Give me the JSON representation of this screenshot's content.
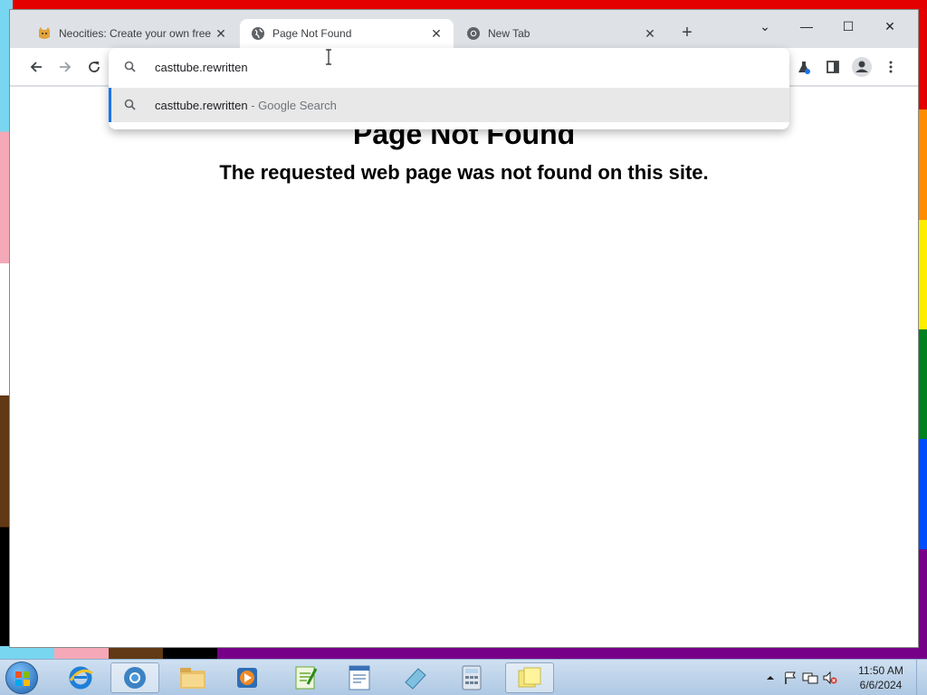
{
  "colors": {
    "wallpaper_stripes": [
      "#e50000",
      "#ff8d00",
      "#ffee00",
      "#028121",
      "#004cff",
      "#770088"
    ],
    "wallpaper_left": [
      "#78d6f0",
      "#f5a9b8",
      "#ffffff",
      "#613915",
      "#000000"
    ],
    "omnibox_accent": "#1a73e8"
  },
  "browser": {
    "tabs": [
      {
        "title": "Neocities: Create your own free",
        "icon": "neocities-cat-icon",
        "active": false
      },
      {
        "title": "Page Not Found",
        "icon": "globe-icon",
        "active": true
      },
      {
        "title": "New Tab",
        "icon": "chrome-icon",
        "active": false
      }
    ],
    "close_glyph": "✕",
    "newtab_glyph": "+",
    "window_controls": {
      "tab_search": "⌄",
      "minimize": "—",
      "maximize": "☐",
      "close": "✕"
    }
  },
  "omnibox": {
    "input_value": "casttube.rewritten",
    "suggestions": [
      {
        "query": "casttube.rewritten",
        "suffix": " - Google Search",
        "icon": "search-icon"
      }
    ]
  },
  "page": {
    "heading": "Page Not Found",
    "message": "The requested web page was not found on this site."
  },
  "taskbar": {
    "apps": [
      {
        "name": "internet-explorer-icon"
      },
      {
        "name": "chrome-icon",
        "active": true
      },
      {
        "name": "file-explorer-icon"
      },
      {
        "name": "media-player-icon"
      },
      {
        "name": "notepad-plus-plus-icon"
      },
      {
        "name": "wordpad-icon"
      },
      {
        "name": "snipping-tool-icon"
      },
      {
        "name": "calculator-icon"
      },
      {
        "name": "sticky-notes-icon",
        "active": true
      }
    ],
    "clock": {
      "time": "11:50 AM",
      "date": "6/6/2024"
    }
  }
}
